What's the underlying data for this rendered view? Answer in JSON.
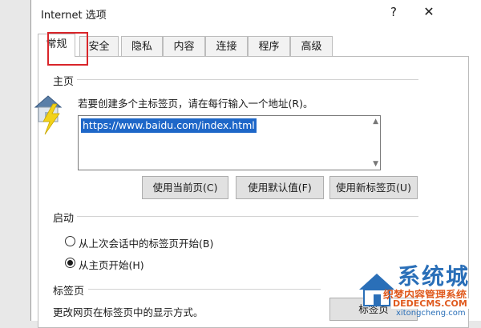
{
  "window": {
    "title": "Internet 选项",
    "help_glyph": "?",
    "close_glyph": "✕"
  },
  "tabs": [
    {
      "label": "常规",
      "active": true
    },
    {
      "label": "安全",
      "active": false,
      "highlighted": true
    },
    {
      "label": "隐私",
      "active": false
    },
    {
      "label": "内容",
      "active": false
    },
    {
      "label": "连接",
      "active": false
    },
    {
      "label": "程序",
      "active": false
    },
    {
      "label": "高级",
      "active": false
    }
  ],
  "homepage": {
    "group_label": "主页",
    "description": "若要创建多个主标签页，请在每行输入一个地址(R)。",
    "url_value": "https://www.baidu.com/index.html",
    "buttons": [
      "使用当前页(C)",
      "使用默认值(F)",
      "使用新标签页(U)"
    ]
  },
  "startup": {
    "group_label": "启动",
    "options": [
      {
        "label": "从上次会话中的标签页开始(B)",
        "checked": false
      },
      {
        "label": "从主页开始(H)",
        "checked": true
      }
    ]
  },
  "tabs_section": {
    "group_label": "标签页",
    "description": "更改网页在标签页中的显示方式。",
    "button_label": "标签页"
  },
  "watermark": {
    "name": "系统城",
    "subtitle": "织梦内容管理系统",
    "subtitle2": "DEDECMS.COM",
    "url": "xitongcheng.com"
  },
  "colors": {
    "highlight_border": "#d9252a",
    "selection": "#1e67c8",
    "watermark_blue": "#2a6fb8",
    "watermark_orange": "#e05a1e"
  },
  "icons": {
    "homepage": "house-with-lightning-icon",
    "radio": "radio-button-icon"
  }
}
